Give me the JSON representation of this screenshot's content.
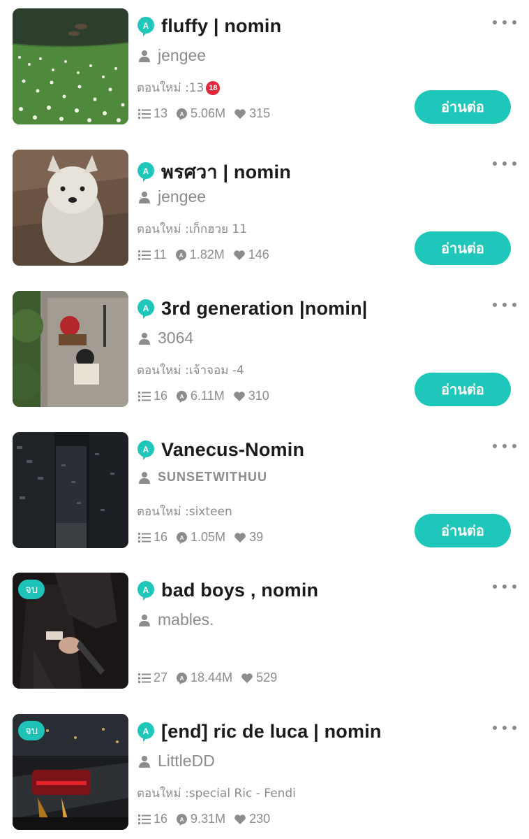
{
  "colors": {
    "accent": "#1fc7bb",
    "muted": "#8c8c8c",
    "rating": "#e2263b"
  },
  "labels": {
    "latest_prefix": "ตอนใหม่ :",
    "read_button": "อ่านต่อ",
    "end_badge": "จบ"
  },
  "stories": [
    {
      "title": "fluffy | nomin",
      "author": "jengee",
      "latest": "13",
      "rating_badge": "18",
      "chapters": "13",
      "views": "5.06M",
      "likes": "315",
      "thumb": "lake-flowers"
    },
    {
      "title": "พรศวา | nomin",
      "author": "jengee",
      "latest": "เก็กฮวย 11",
      "chapters": "11",
      "views": "1.82M",
      "likes": "146",
      "thumb": "white-puppy"
    },
    {
      "title": "3rd generation |nomin|",
      "author": "3064",
      "latest": "เจ้าจอม -4",
      "chapters": "16",
      "views": "6.11M",
      "likes": "310",
      "thumb": "courtyard"
    },
    {
      "title": "Vanecus-Nomin",
      "author": "SUNSETWITHUU",
      "latest": "sixteen",
      "chapters": "16",
      "views": "1.05M",
      "likes": "39",
      "thumb": "night-city"
    },
    {
      "title": "bad boys , nomin",
      "author": "mables.",
      "chapters": "27",
      "views": "18.44M",
      "likes": "529",
      "thumb": "dark-suit",
      "ended": true
    },
    {
      "title": "[end] ric de luca | nomin",
      "author": "LittleDD",
      "latest": "special Ric - Fendi",
      "chapters": "16",
      "views": "9.31M",
      "likes": "230",
      "thumb": "race-car",
      "ended": true
    }
  ]
}
